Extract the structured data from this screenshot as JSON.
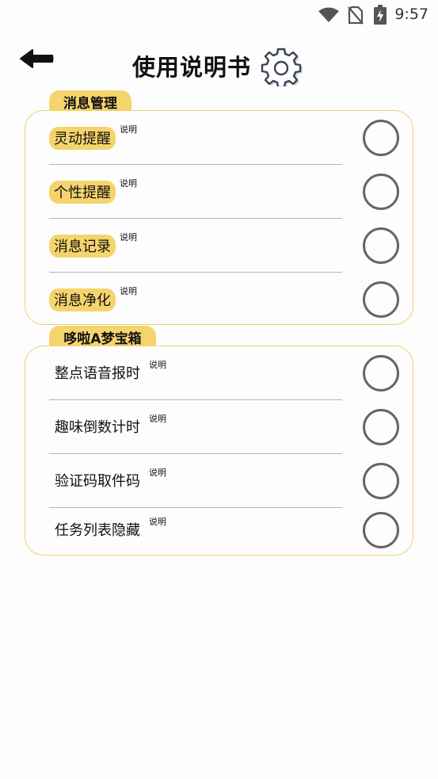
{
  "status_bar": {
    "time": "9:57",
    "icons": [
      "wifi-icon",
      "no-sim-icon",
      "battery-charging-icon"
    ]
  },
  "header": {
    "back_icon": "arrow-left-icon",
    "title": "使用说明书",
    "title_icon": "gear-icon"
  },
  "sections": [
    {
      "title": "消息管理",
      "items": [
        {
          "label": "灵动提醒",
          "note": "说明",
          "highlighted": true
        },
        {
          "label": "个性提醒",
          "note": "说明",
          "highlighted": true
        },
        {
          "label": "消息记录",
          "note": "说明",
          "highlighted": true
        },
        {
          "label": "消息净化",
          "note": "说明",
          "highlighted": true
        }
      ]
    },
    {
      "title": "哆啦A梦宝箱",
      "items": [
        {
          "label": "整点语音报时",
          "note": "说明",
          "highlighted": false
        },
        {
          "label": "趣味倒数计时",
          "note": "说明",
          "highlighted": false
        },
        {
          "label": "验证码取件码",
          "note": "说明",
          "highlighted": false
        },
        {
          "label": "任务列表隐藏",
          "note": "说明",
          "highlighted": false
        }
      ]
    }
  ],
  "colors": {
    "accent": "#f6d46d",
    "card_border": "#f2d06b",
    "toggle_border": "#666666",
    "divider": "#b5b5b5"
  }
}
